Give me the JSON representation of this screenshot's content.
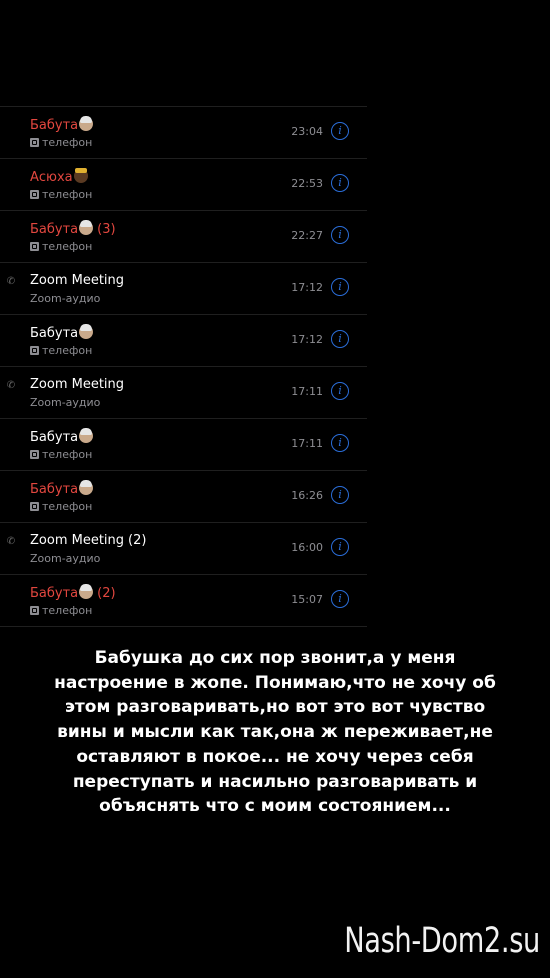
{
  "calls": [
    {
      "name": "Бабута",
      "count": "",
      "missed": true,
      "emoji": "granny",
      "phone_mark": false,
      "sub": "телефон",
      "time": "23:04"
    },
    {
      "name": "Асюха",
      "count": "",
      "missed": true,
      "emoji": "prince",
      "phone_mark": false,
      "sub": "телефон",
      "time": "22:53"
    },
    {
      "name": "Бабута",
      "count": "(3)",
      "missed": true,
      "emoji": "granny",
      "phone_mark": false,
      "sub": "телефон",
      "time": "22:27"
    },
    {
      "name": "Zoom Meeting",
      "count": "",
      "missed": false,
      "emoji": "",
      "phone_mark": true,
      "sub": "Zoom-аудио",
      "time": "17:12"
    },
    {
      "name": "Бабута",
      "count": "",
      "missed": false,
      "emoji": "granny",
      "phone_mark": false,
      "sub": "телефон",
      "time": "17:12"
    },
    {
      "name": "Zoom Meeting",
      "count": "",
      "missed": false,
      "emoji": "",
      "phone_mark": true,
      "sub": "Zoom-аудио",
      "time": "17:11"
    },
    {
      "name": "Бабута",
      "count": "",
      "missed": false,
      "emoji": "granny",
      "phone_mark": false,
      "sub": "телефон",
      "time": "17:11"
    },
    {
      "name": "Бабута",
      "count": "",
      "missed": true,
      "emoji": "granny",
      "phone_mark": false,
      "sub": "телефон",
      "time": "16:26"
    },
    {
      "name": "Zoom Meeting",
      "count": "(2)",
      "missed": false,
      "emoji": "",
      "phone_mark": true,
      "sub": "Zoom-аудио",
      "time": "16:00"
    },
    {
      "name": "Бабута",
      "count": "(2)",
      "missed": true,
      "emoji": "granny",
      "phone_mark": false,
      "sub": "телефон",
      "time": "15:07"
    }
  ],
  "caption": {
    "lines": [
      "Бабушка до сих пор звонит,а у меня",
      "настроение в жопе. Понимаю,что не хочу об",
      "этом разговаривать,но вот это вот чувство",
      "вины и мысли как так,она ж переживает,не",
      "оставляют в  покое... не хочу через себя",
      "переступать и насильно разговаривать и",
      "объяснять что с моим состоянием..."
    ]
  },
  "watermark": "Nash-Dom2.su",
  "colors": {
    "missed": "#e2473f",
    "info_blue": "#2a6dd8",
    "secondary": "#8e8e93"
  },
  "icons": {
    "info": "info-circle-icon",
    "sub": "phone-sim-icon",
    "phone_mark": "phone-handset-icon"
  }
}
